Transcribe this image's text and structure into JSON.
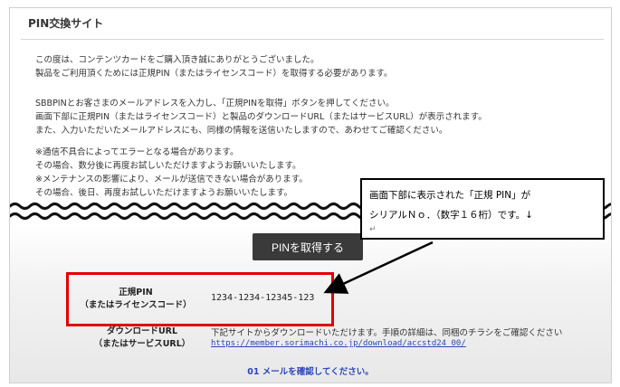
{
  "page": {
    "title": "PIN交換サイト",
    "intro": [
      "この度は、コンテンツカードをご購入頂き誠にありがとうございました。",
      "製品をご利用頂くためには正規PIN（またはライセンスコード）を取得する必要があります。"
    ],
    "instructions": [
      "SBBPINとお客さまのメールアドレスを入力し、「正規PINを取得」ボタンを押してください。",
      "画面下部に正規PIN（またはライセンスコード）と製品のダウンロードURL（またはサービスURL）が表示されます。",
      "また、入力いただいたメールアドレスにも、同様の情報を送信いたしますので、あわせてご確認ください。"
    ],
    "notes": [
      "※通信不具合によってエラーとなる場合があります。",
      "その場合、数分後に再度お試しいただけますようお願いいたします。",
      "※メンテナンスの影響により、メールが送信できない場合があります。",
      "その場合、後日、再度お試しいただけますようお願いいたします。"
    ],
    "get_pin_button": "PINを取得する",
    "pin_label_line1": "正規PIN",
    "pin_label_line2": "（またはライセンスコード）",
    "pin_value": "1234-1234-12345-123",
    "download_label_line1": "ダウンロードURL",
    "download_label_line2": "（またはサービスURL）",
    "download_text": "下記サイトからダウンロードいただけます。手順の詳細は、同梱のチラシをご確認ください",
    "download_url": "https://member.sorimachi.co.jp/download/accstd24_00/",
    "bottom_note": "01 メールを確認してください。"
  },
  "callout": {
    "line1": "画面下部に表示された「正規 PIN」が",
    "line2": "シリアルＮｏ．（数字１６桁）です。↓",
    "return_mark": "↵"
  },
  "colors": {
    "highlight_border": "#e00000",
    "link": "#2a49b0",
    "note_blue": "#2b46b8",
    "button_bg": "#3a3a3a"
  }
}
